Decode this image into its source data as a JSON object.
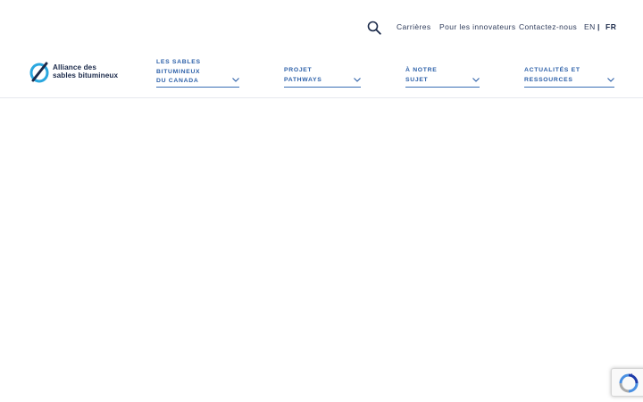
{
  "utility_nav": {
    "careers": "Carrières",
    "innovators": "Pour les innovateurs",
    "contact": "Contactez-nous"
  },
  "language": {
    "en": "EN",
    "separator": "|",
    "fr": "FR",
    "active": "FR"
  },
  "logo": {
    "line1": "Alliance des",
    "line2": "sables bitumineux"
  },
  "main_nav": [
    {
      "label": "LES SABLES\nBITUMINEUX\nDU CANADA"
    },
    {
      "label": "PROJET\nPATHWAYS"
    },
    {
      "label": "À NOTRE\nSUJET"
    },
    {
      "label": "ACTUALITÉS ET\nRESSOURCES"
    }
  ],
  "icons": {
    "search": "search-icon",
    "chevron": "chevron-down-icon",
    "recaptcha": "recaptcha-icon"
  },
  "colors": {
    "nav_blue": "#2b5fa8",
    "text_dark": "#1b2a4a",
    "logo_cyan": "#2aa7df",
    "logo_navy": "#1b2a4a"
  }
}
